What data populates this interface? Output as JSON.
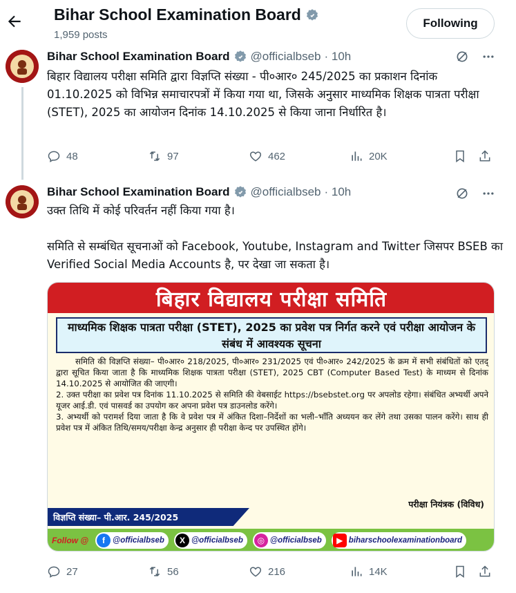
{
  "header": {
    "title": "Bihar School Examination Board",
    "posts": "1,959 posts",
    "follow_label": "Following"
  },
  "tweets": [
    {
      "name": "Bihar School Examination Board",
      "handle": "@officialbseb",
      "time": "· 10h",
      "text": "बिहार विद्यालय परीक्षा समिति द्वारा विज्ञप्ति संख्या - पी०आर० 245/2025 का प्रकाशन दिनांक 01.10.2025 को विभिन्न समाचारपत्रों में किया गया था, जिसके अनुसार माध्यमिक शिक्षक पात्रता परीक्षा (STET), 2025 का आयोजन दिनांक 14.10.2025 से किया जाना निर्धारित है।",
      "replies": "48",
      "reposts": "97",
      "likes": "462",
      "views": "20K"
    },
    {
      "name": "Bihar School Examination Board",
      "handle": "@officialbseb",
      "time": "· 10h",
      "text_line1": "उक्त तिथि में कोई परिवर्तन नहीं किया गया है।",
      "text_line2": "समिति से सम्बंधित सूचनाओं को Facebook, Youtube, Instagram and Twitter जिसपर BSEB का Verified Social Media Accounts है, पर देखा जा सकता है।",
      "replies": "27",
      "reposts": "56",
      "likes": "216",
      "views": "14K"
    }
  ],
  "notice": {
    "banner": "बिहार विद्यालय परीक्षा समिति",
    "subject": "माध्यमिक शिक्षक पात्रता परीक्षा (STET), 2025 का प्रवेश पत्र निर्गत करने एवं परीक्षा आयोजन के संबंध में आवश्यक सूचना",
    "para1": "समिति की विज्ञप्ति संख्या– पी०आर० 218/2025, पी०आर० 231/2025 एवं पी०आर० 242/2025 के क्रम में सभी संबंधितों को एतद् द्वारा सूचित किया जाता है कि माध्यमिक शिक्षक पात्रता परीक्षा (STET), 2025 CBT (Computer Based Test) के माध्यम से दिनांक 14.10.2025 से आयोजित की जाएगी।",
    "para2": "2. उक्त परीक्षा का प्रवेश पत्र दिनांक 11.10.2025 से समिति की वेबसाईट https://bsebstet.org पर अपलोड रहेगा। संबंधित अभ्यर्थी अपने यूजर आई.डी. एवं पासवर्ड का उपयोग कर अपना प्रवेश पत्र डाउनलोड करेंगे।",
    "para3": "3. अभ्यर्थी को परामर्श दिया जाता है कि वे प्रवेश पत्र में अंकित दिशा–निर्देशों का भली–भाँति अध्ययन कर लेंगे तथा उसका पालन करेंगे। साथ ही प्रवेश पत्र में अंकित तिथि/समय/परीक्षा केन्द्र अनुसार ही परीक्षा केन्द पर उपस्थित होंगे।",
    "signatory": "परीक्षा नियंत्रक (विविध)",
    "ref": "विज्ञप्ति संख्या– पी.आर. 245/2025",
    "follow": "Follow @",
    "facebook": "@officialbseb",
    "x": "@officialbseb",
    "instagram": "@officialbseb",
    "youtube": "biharschoolexaminationboard"
  },
  "colors": {
    "verified": "#829aab",
    "banner": "#d11e22",
    "social_bar": "#7bc242"
  }
}
